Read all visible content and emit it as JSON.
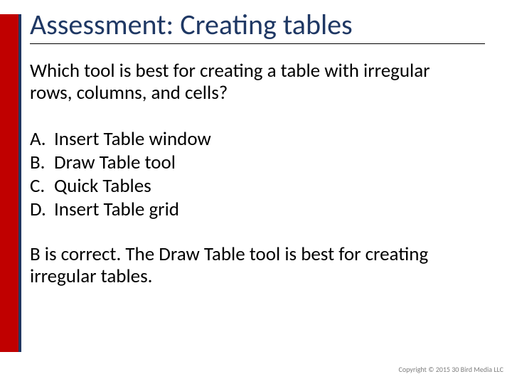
{
  "title": "Assessment: Creating tables",
  "question": "Which tool is best for creating a table with irregular rows, columns, and cells?",
  "options": [
    {
      "letter": "A.",
      "text": "Insert Table window"
    },
    {
      "letter": "B.",
      "text": "Draw Table tool"
    },
    {
      "letter": "C.",
      "text": "Quick Tables"
    },
    {
      "letter": "D.",
      "text": "Insert Table grid"
    }
  ],
  "answer": "B is correct. The Draw Table tool is best for creating irregular tables.",
  "copyright": "Copyright © 2015 30 Bird Media LLC"
}
